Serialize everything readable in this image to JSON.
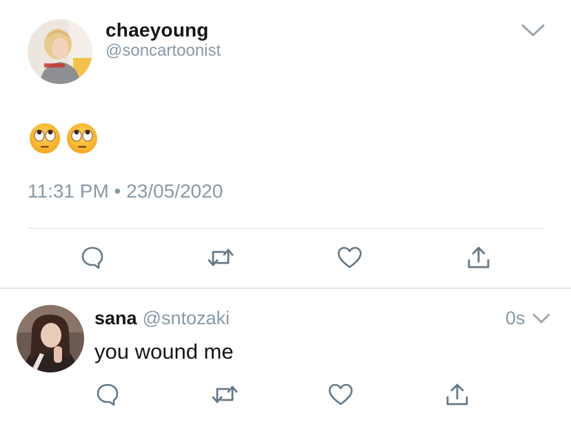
{
  "main_tweet": {
    "author_name": "chaeyoung",
    "author_handle": "@soncartoonist",
    "body_emoji": [
      "🙄",
      "🙄"
    ],
    "timestamp": "11:31 PM • 23/05/2020",
    "icons": {
      "reply": "reply-icon",
      "retweet": "retweet-icon",
      "like": "heart-icon",
      "share": "share-icon",
      "menu": "chevron-down-icon"
    }
  },
  "reply_tweet": {
    "author_name": "sana",
    "author_handle": "@sntozaki",
    "time": "0s",
    "text": "you wound me",
    "icons": {
      "reply": "reply-icon",
      "retweet": "retweet-icon",
      "like": "heart-icon",
      "share": "share-icon",
      "menu": "chevron-down-icon"
    }
  },
  "colors": {
    "text_primary": "#14171a",
    "text_secondary": "#8899a6",
    "icon": "#657786",
    "divider": "#d6dbdf"
  }
}
